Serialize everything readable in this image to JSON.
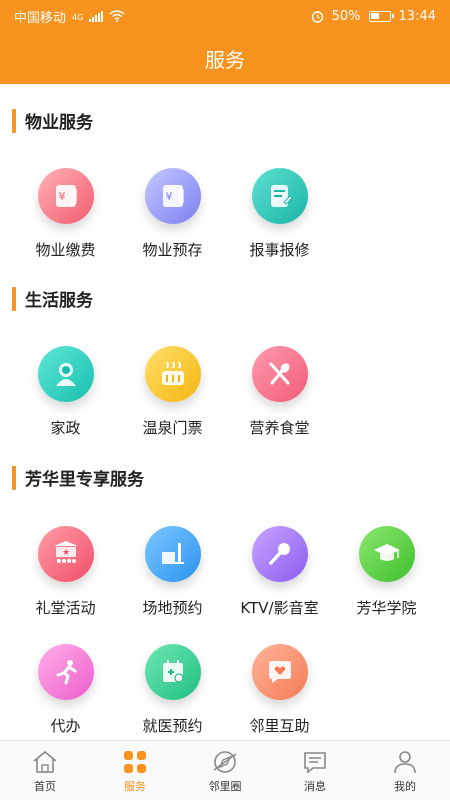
{
  "status_bar": {
    "carrier": "中国移动",
    "network": "4G",
    "battery": "50%",
    "time": "13:44"
  },
  "header": {
    "title": "服务"
  },
  "sections": [
    {
      "title": "物业服务",
      "items": [
        {
          "label": "物业缴费",
          "icon": "payment-card-icon"
        },
        {
          "label": "物业预存",
          "icon": "prepay-card-icon"
        },
        {
          "label": "报事报修",
          "icon": "repair-form-icon"
        }
      ]
    },
    {
      "title": "生活服务",
      "items": [
        {
          "label": "家政",
          "icon": "housekeeper-icon"
        },
        {
          "label": "温泉门票",
          "icon": "hot-spring-icon"
        },
        {
          "label": "营养食堂",
          "icon": "knife-spoon-icon"
        }
      ]
    },
    {
      "title": "芳华里专享服务",
      "items": [
        {
          "label": "礼堂活动",
          "icon": "auditorium-icon"
        },
        {
          "label": "场地预约",
          "icon": "venue-icon"
        },
        {
          "label": "KTV/影音室",
          "icon": "microphone-icon"
        },
        {
          "label": "芳华学院",
          "icon": "graduation-cap-icon"
        },
        {
          "label": "代办",
          "icon": "runner-icon"
        },
        {
          "label": "就医预约",
          "icon": "medical-calendar-icon"
        },
        {
          "label": "邻里互助",
          "icon": "heart-chat-icon"
        }
      ]
    }
  ],
  "tabbar": [
    {
      "label": "首页",
      "icon": "home-icon"
    },
    {
      "label": "服务",
      "icon": "grid-icon",
      "active": true
    },
    {
      "label": "邻里圈",
      "icon": "compass-icon"
    },
    {
      "label": "消息",
      "icon": "message-icon"
    },
    {
      "label": "我的",
      "icon": "person-icon"
    }
  ],
  "colors": {
    "accent": "#f7931e"
  }
}
